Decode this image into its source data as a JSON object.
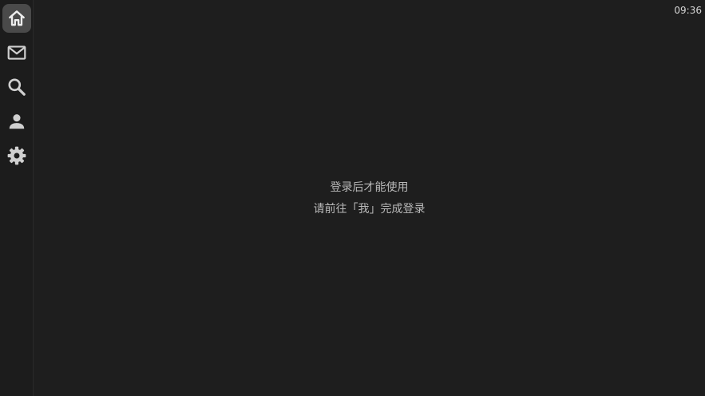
{
  "status_bar": {
    "time": "09:36"
  },
  "sidebar": {
    "items": [
      {
        "name": "home",
        "icon": "home-icon",
        "active": true
      },
      {
        "name": "mail",
        "icon": "mail-icon",
        "active": false
      },
      {
        "name": "search",
        "icon": "search-icon",
        "active": false
      },
      {
        "name": "profile",
        "icon": "person-icon",
        "active": false
      },
      {
        "name": "settings",
        "icon": "gear-icon",
        "active": false
      }
    ]
  },
  "main": {
    "login_required": "登录后才能使用",
    "login_hint": "请前往「我」完成登录"
  },
  "colors": {
    "background": "#1e1e1e",
    "sidebar_background": "#1c1c1c",
    "active_highlight": "#4a4a4a",
    "icon": "#d0d0d0",
    "text": "#b9b9b9"
  }
}
